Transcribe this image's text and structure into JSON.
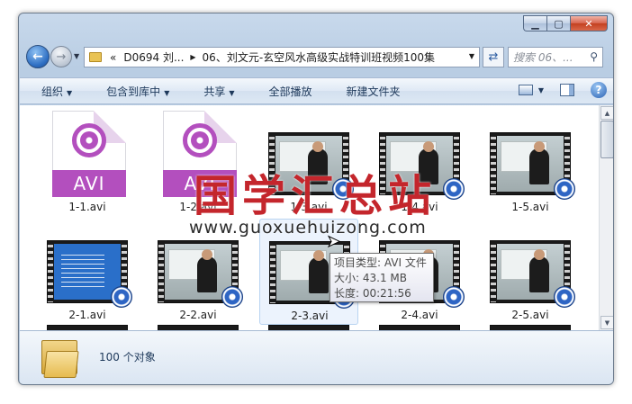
{
  "window": {
    "caption_minimize": "▁",
    "caption_maximize": "▢",
    "caption_close": "✕"
  },
  "nav": {
    "address_prefix": "«",
    "address_segments": [
      "D0694 刘...",
      "06、刘文元-玄空风水高级实战特训班视频100集"
    ],
    "search_placeholder": "搜索 06、..."
  },
  "toolbar": {
    "organize": "组织",
    "include_in_library": "包含到库中",
    "share": "共享",
    "play_all": "全部播放",
    "new_folder": "新建文件夹"
  },
  "files": [
    {
      "name": "1-1.avi",
      "kind": "doc"
    },
    {
      "name": "1-2.avi",
      "kind": "doc"
    },
    {
      "name": "1-3.avi",
      "kind": "video"
    },
    {
      "name": "1-4.avi",
      "kind": "video"
    },
    {
      "name": "1-5.avi",
      "kind": "video"
    },
    {
      "name": "2-1.avi",
      "kind": "video-blue"
    },
    {
      "name": "2-2.avi",
      "kind": "video"
    },
    {
      "name": "2-3.avi",
      "kind": "video"
    },
    {
      "name": "2-4.avi",
      "kind": "video"
    },
    {
      "name": "2-5.avi",
      "kind": "video"
    }
  ],
  "avi_label": "AVI",
  "tooltip": {
    "type_line": "项目类型: AVI 文件",
    "size_line": "大小: 43.1 MB",
    "length_line": "长度: 00:21:56"
  },
  "watermark": {
    "title": "国学汇总站",
    "url": "www.guoxuehuizong.com"
  },
  "details": {
    "count": "100 个对象"
  },
  "colors": {
    "avi_purple": "#b34fbe",
    "watermark_red": "#c4262c",
    "toolbar_text": "#1e395b"
  }
}
